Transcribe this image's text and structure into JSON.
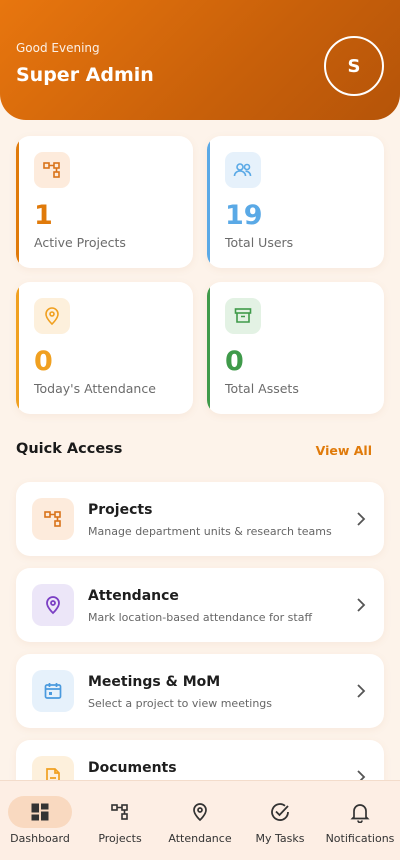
{
  "header": {
    "greeting": "Good Evening",
    "user_name": "Super Admin",
    "avatar_initial": "S"
  },
  "stats": [
    {
      "value": "1",
      "label": "Active Projects",
      "icon": "hierarchy-icon",
      "accent": "#e07a0a"
    },
    {
      "value": "19",
      "label": "Total Users",
      "icon": "users-icon",
      "accent": "#5aa9e6"
    },
    {
      "value": "0",
      "label": "Today's Attendance",
      "icon": "location-pin-icon",
      "accent": "#f0a020"
    },
    {
      "value": "0",
      "label": "Total Assets",
      "icon": "archive-box-icon",
      "accent": "#3f9a4a"
    }
  ],
  "quick_access": {
    "title": "Quick Access",
    "view_all": "View All",
    "items": [
      {
        "title": "Projects",
        "description": "Manage department units & research teams",
        "icon": "hierarchy-icon"
      },
      {
        "title": "Attendance",
        "description": "Mark location-based attendance for staff",
        "icon": "location-pin-icon"
      },
      {
        "title": "Meetings & MoM",
        "description": "Select a project to view meetings",
        "icon": "calendar-icon"
      },
      {
        "title": "Documents",
        "description": "",
        "icon": "document-icon"
      }
    ]
  },
  "bottom_nav": {
    "active": "Dashboard",
    "items": [
      {
        "label": "Dashboard",
        "icon": "grid-icon"
      },
      {
        "label": "Projects",
        "icon": "hierarchy-icon"
      },
      {
        "label": "Attendance",
        "icon": "location-pin-icon"
      },
      {
        "label": "My Tasks",
        "icon": "check-circle-icon"
      },
      {
        "label": "Notifications",
        "icon": "bell-icon"
      }
    ]
  }
}
